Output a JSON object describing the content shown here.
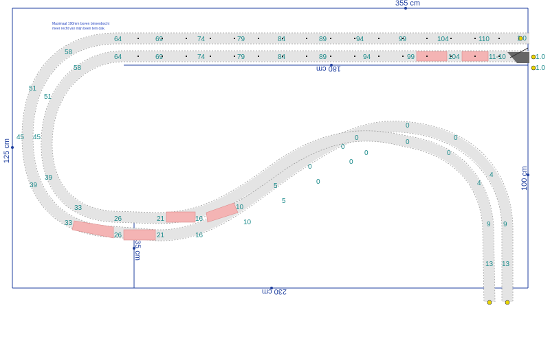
{
  "note": {
    "line1": "Maximaal 190mm boven binnenbocht",
    "line2": "meer recht van mijn been tem dak."
  },
  "dimensions": {
    "width_total": "355 cm",
    "height_total": "125 cm",
    "height_right": "100 cm",
    "bottom_width": "230 cm",
    "top_inner": "180 cm",
    "small_vertical": "35 cm"
  },
  "labels": {
    "outer_top": [
      "64",
      "69",
      "74",
      "79",
      "84",
      "89",
      "94",
      "99",
      "104",
      "110"
    ],
    "inner_top": [
      "64",
      "69",
      "74",
      "79",
      "84",
      "89",
      "94",
      "99",
      "104"
    ],
    "inner_top_switch": "11-10",
    "end_marker": "1.0",
    "left_outer": [
      "58",
      "51",
      "45",
      "39",
      "33"
    ],
    "left_inner": [
      "58",
      "51",
      "45",
      "39",
      "33"
    ],
    "bottom_inner": [
      "26",
      "21",
      "16",
      "10"
    ],
    "bottom_outer": [
      "26",
      "21",
      "16",
      "10"
    ],
    "mid_inner": [
      "5",
      "0",
      "0",
      "0",
      "0"
    ],
    "mid_outer": [
      "5",
      "0",
      "0",
      "0",
      "0"
    ],
    "right_curve_inner": [
      "0",
      "4",
      "9",
      "13"
    ],
    "right_curve_outer": [
      "0",
      "4",
      "9",
      "13"
    ]
  },
  "colors": {
    "dimension": "#1f3f9f",
    "label": "#1a8a8a",
    "track": "#e4e4e4",
    "highlight": "#f4b4b4"
  }
}
